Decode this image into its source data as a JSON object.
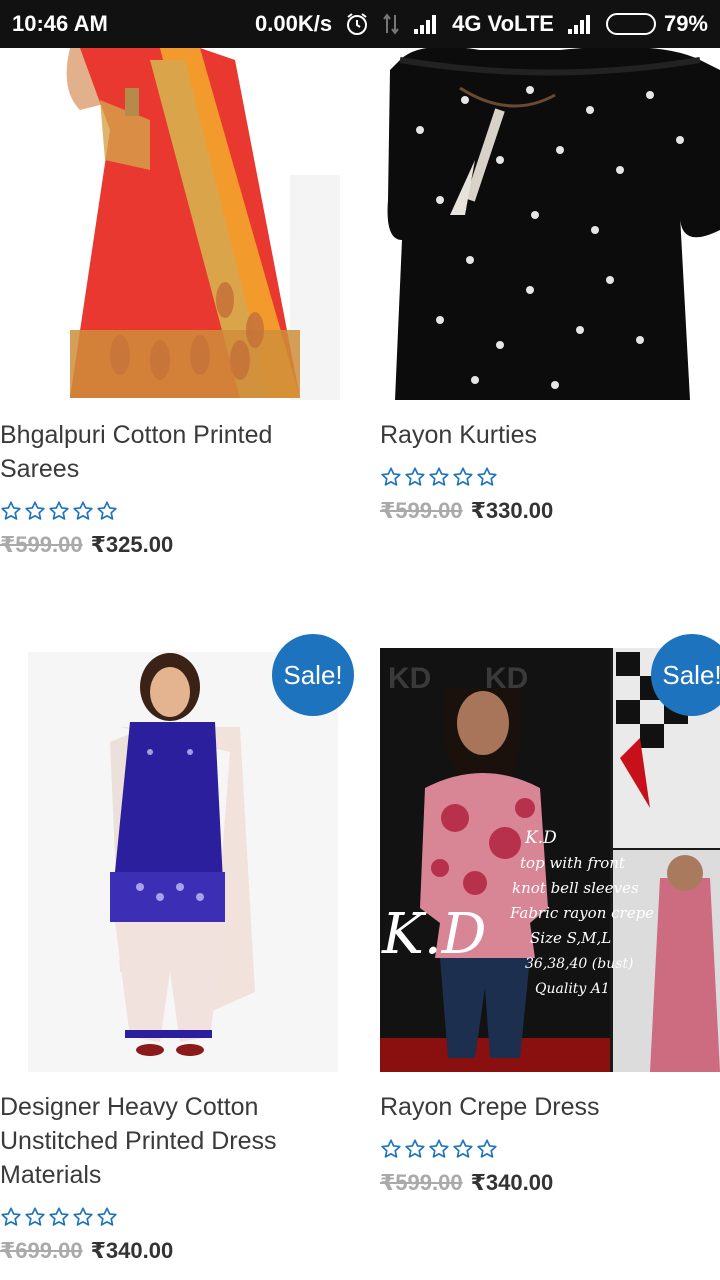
{
  "status_bar": {
    "time": "10:46 AM",
    "speed": "0.00K/s",
    "network": "4G VoLTE",
    "battery": "79%",
    "battery_level": 0.79
  },
  "products": [
    {
      "title": "Bhgalpuri Cotton Printed Sarees",
      "old_price": "₹599.00",
      "price": "₹325.00",
      "rating": 0,
      "sale": false
    },
    {
      "title": "Rayon Kurties",
      "old_price": "₹599.00",
      "price": "₹330.00",
      "rating": 0,
      "sale": false
    },
    {
      "title": "Designer Heavy Cotton Unstitched Printed Dress Materials",
      "old_price": "₹699.00",
      "price": "₹340.00",
      "rating": 0,
      "sale": true,
      "sale_label": "Sale!"
    },
    {
      "title": "Rayon Crepe Dress",
      "old_price": "₹599.00",
      "price": "₹340.00",
      "rating": 0,
      "sale": true,
      "sale_label": "Sale!",
      "image_caption": {
        "brand": "K.D",
        "lines": [
          "K.D",
          "top with front",
          "knot bell sleeves",
          "Fabric rayon crepe",
          "Size S,M,L",
          "36,38,40 (bust)",
          "Quality A1"
        ]
      }
    }
  ],
  "colors": {
    "accent": "#1e73be",
    "star": "#1e73be",
    "old_price": "#aaaaaa"
  }
}
